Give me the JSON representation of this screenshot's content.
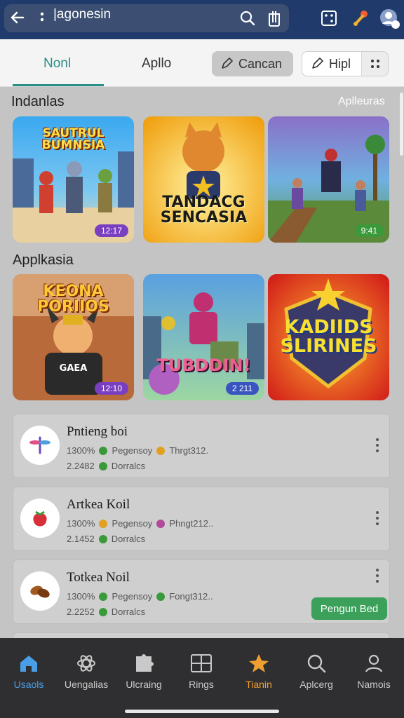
{
  "topbar": {
    "url_text": "|agonesin",
    "icons": [
      "back-arrow-icon",
      "more-vertical-icon",
      "search-icon",
      "trash-icon",
      "dice-icon",
      "joystick-icon",
      "profile-badge-icon"
    ],
    "badge": "0"
  },
  "header": {
    "tabs": [
      {
        "label": "Nonl",
        "active": true
      },
      {
        "label": "Apllo",
        "active": false
      }
    ],
    "gray_button_label": "Cancan",
    "white_button_label": "Hipl"
  },
  "sections": {
    "first": {
      "title": "Indanlas",
      "link": "Aplleuras"
    },
    "second": {
      "title": "Applkasia"
    }
  },
  "cards_row1": [
    {
      "title": "SAUTRUL BUMNSIA",
      "badge": "12:17",
      "accent": "#2e8fe0"
    },
    {
      "title": "TANDACG SENCASIA",
      "badge": "",
      "accent": "#f2b320"
    },
    {
      "title": "",
      "badge": "9:41",
      "accent": "#4aa0d8"
    }
  ],
  "cards_row2": [
    {
      "title": "KEONA PORIIOS",
      "subtitle": "GAEA",
      "badge": "12:10",
      "accent": "#b0663a"
    },
    {
      "title": "TUBDDIN!",
      "badge": "2 211",
      "accent": "#6aa8e0"
    },
    {
      "title": "KADIIDS SLIRINES",
      "badge": "",
      "accent": "#e0301e"
    }
  ],
  "list": [
    {
      "name": "Pntieng boi",
      "percent": "1300%",
      "tag1": "Pegensoy",
      "tag2": "Thrgt312.",
      "size": "2.2482",
      "tag3": "Dorralcs",
      "icon": "dragonfly-icon"
    },
    {
      "name": "Artkea Koil",
      "percent": "1300%",
      "tag1": "Pegensoy",
      "tag2": "Phngt212..",
      "size": "2.1452",
      "tag3": "Dorralcs",
      "icon": "strawberry-icon"
    },
    {
      "name": "Totkea Noil",
      "percent": "1300%",
      "tag1": "Pegensoy",
      "tag2": "Fongt312..",
      "size": "2.2252",
      "tag3": "Dorralcs",
      "icon": "nuts-icon"
    }
  ],
  "action_button": "Pengun Bed",
  "bottom_nav": [
    {
      "label": "Usaols",
      "icon": "home-icon",
      "state": "active"
    },
    {
      "label": "Uengalias",
      "icon": "atom-icon",
      "state": "normal"
    },
    {
      "label": "Ulcraing",
      "icon": "puzzle-icon",
      "state": "normal"
    },
    {
      "label": "Rings",
      "icon": "grid-icon",
      "state": "normal"
    },
    {
      "label": "Tianin",
      "icon": "star-person-icon",
      "state": "orange"
    },
    {
      "label": "Aplcerg",
      "icon": "search-icon",
      "state": "normal"
    },
    {
      "label": "Namois",
      "icon": "person-icon",
      "state": "normal"
    }
  ]
}
